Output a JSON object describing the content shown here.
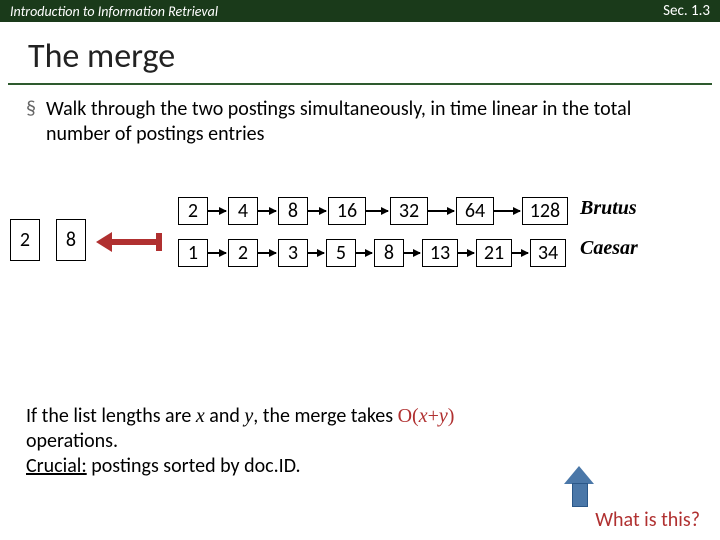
{
  "header": {
    "left": "Introduction to Information Retrieval",
    "right": "Sec. 1.3"
  },
  "title": "The merge",
  "bullet_sym": "§",
  "bullet_text": "Walk through the two postings simultaneously, in time linear in the total number of postings entries",
  "pointers": {
    "a": "2",
    "b": "8"
  },
  "row1": [
    "2",
    "4",
    "8",
    "16",
    "32",
    "64",
    "128"
  ],
  "row2": [
    "1",
    "2",
    "3",
    "5",
    "8",
    "13",
    "21",
    "34"
  ],
  "label1": "Brutus",
  "label2": "Caesar",
  "footer": {
    "p1a": "If the list lengths are ",
    "x": "x",
    "p1b": " and ",
    "y": "y",
    "p1c": ", the merge takes ",
    "op": "O",
    "oparen": "(",
    "plus": "+",
    "cparen": ")",
    "p2": "operations.",
    "p3a": "Crucial:",
    "p3b": " postings sorted by doc.ID."
  },
  "what": "What is this?"
}
